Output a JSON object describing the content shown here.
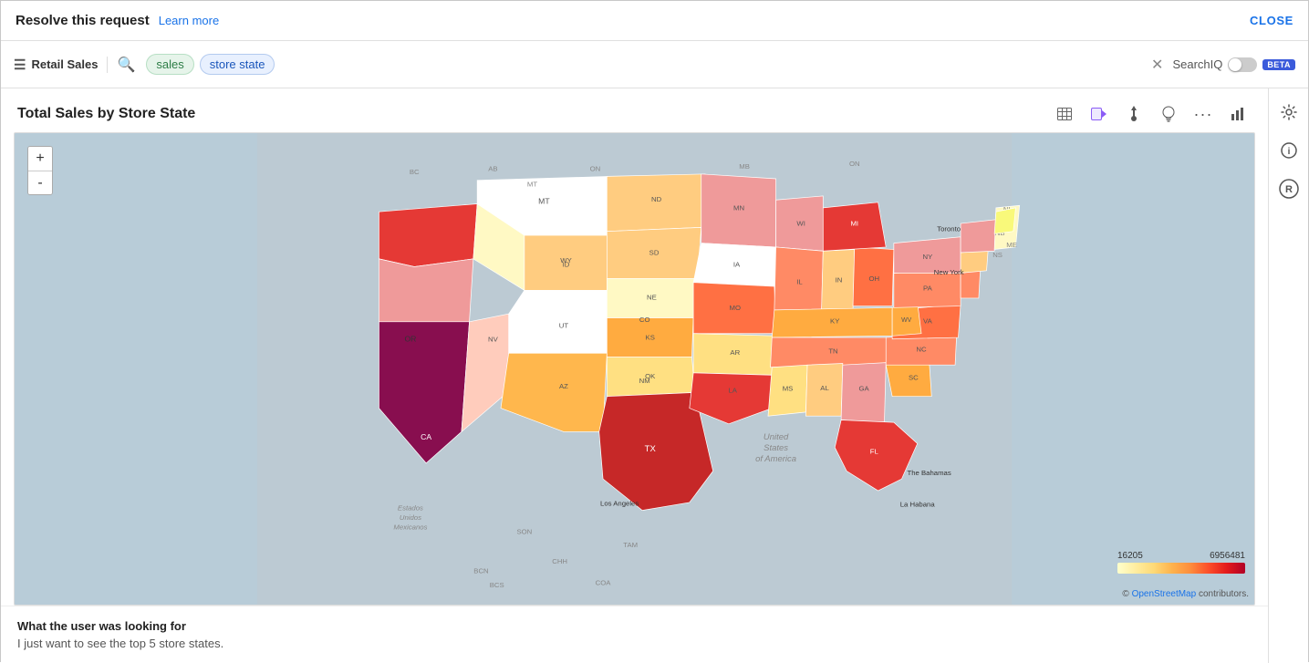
{
  "topbar": {
    "resolve_label": "Resolve this request",
    "learn_more_label": "Learn more",
    "close_label": "CLOSE"
  },
  "searchbar": {
    "datasource_label": "Retail Sales",
    "chips": [
      {
        "label": "sales",
        "type": "green"
      },
      {
        "label": "store state",
        "type": "blue"
      }
    ],
    "searchiq_label": "SearchIQ",
    "beta_label": "BETA"
  },
  "chart": {
    "title": "Total Sales by Store State",
    "tools": [
      {
        "id": "table",
        "icon": "⊞",
        "name": "table-view-btn"
      },
      {
        "id": "video",
        "icon": "▶",
        "name": "video-btn"
      },
      {
        "id": "pin",
        "icon": "📌",
        "name": "pin-btn"
      },
      {
        "id": "lightbulb",
        "icon": "💡",
        "name": "insight-btn"
      },
      {
        "id": "more",
        "icon": "•••",
        "name": "more-btn"
      },
      {
        "id": "bar",
        "icon": "📊",
        "name": "chart-type-btn"
      }
    ]
  },
  "legend": {
    "min_value": "16205",
    "max_value": "6956481"
  },
  "bottom_panel": {
    "heading": "What the user was looking for",
    "text": "I just want to see the top 5 store states."
  },
  "zoom": {
    "plus_label": "+",
    "minus_label": "-"
  },
  "attribution": {
    "text": "© ",
    "link_text": "OpenStreetMap",
    "suffix": " contributors."
  }
}
